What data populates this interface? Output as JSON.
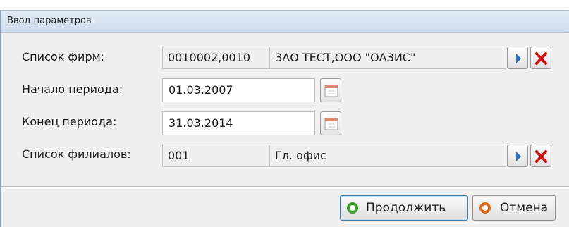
{
  "window": {
    "title": "Ввод параметров"
  },
  "firms": {
    "label": "Список фирм:",
    "codes": "0010002,0010",
    "names": "ЗАО ТЕСТ,ООО \"ОАЗИС\""
  },
  "period_start": {
    "label": "Начало периода:",
    "value": "01.03.2007"
  },
  "period_end": {
    "label": "Конец периода:",
    "value": "31.03.2014"
  },
  "branches": {
    "label": "Список филиалов:",
    "code": "001",
    "name": "Гл. офис"
  },
  "buttons": {
    "continue": "Продолжить",
    "cancel": "Отмена"
  },
  "colors": {
    "arrow_blue": "#2e6fc0",
    "clear_red": "#d01010",
    "continue_green": "#3aa02a",
    "cancel_orange": "#e06a10"
  }
}
